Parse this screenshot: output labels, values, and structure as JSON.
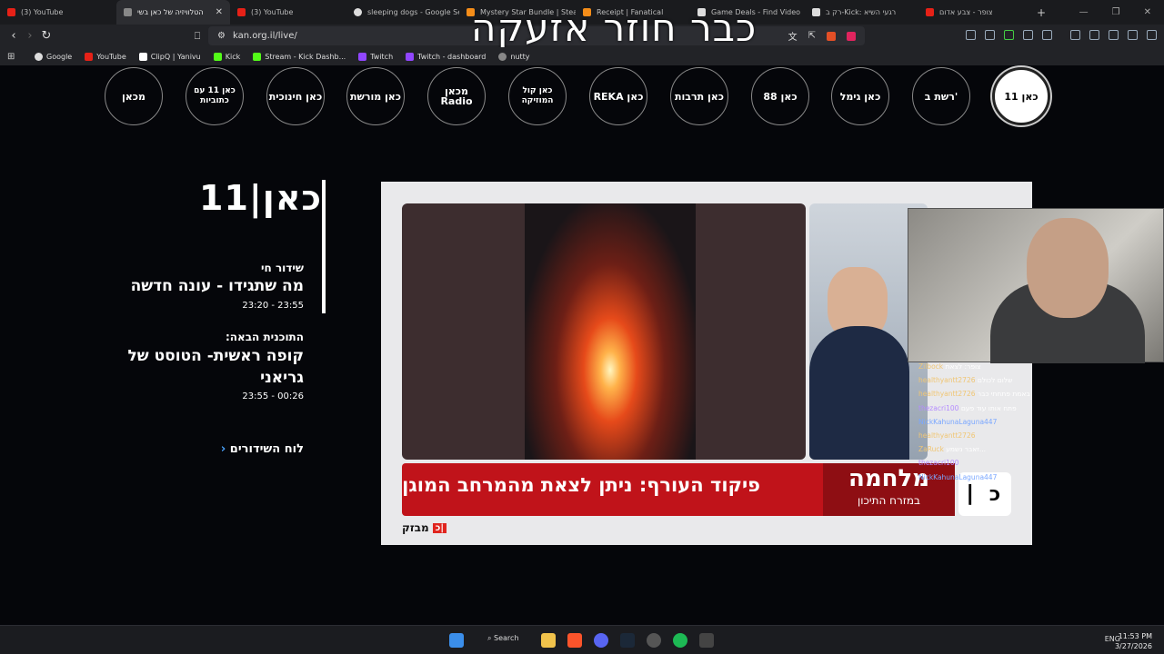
{
  "tabs": [
    {
      "label": "(3) YouTube",
      "color": "#e62117"
    },
    {
      "label": "הטלוויזיה של כאן בשי",
      "color": "#888"
    },
    {
      "label": "(3) YouTube",
      "color": "#e62117"
    },
    {
      "label": "sleeping dogs - Google Se",
      "color": "#ddd"
    },
    {
      "label": "Mystery Star Bundle | Stea",
      "color": "#f58d19"
    },
    {
      "label": "Receipt | Fanatical",
      "color": "#f58d19"
    },
    {
      "label": "Game Deals - Find Video",
      "color": "#ddd"
    },
    {
      "label": "רק ב-Kick: רגעי השיא",
      "color": "#ddd"
    },
    {
      "label": "צופר - צבע אדום",
      "color": "#e62117"
    }
  ],
  "address": {
    "url": "kan.org.il/live/"
  },
  "overlay_title": "כבר חוזר אזעקה",
  "bookmarks": [
    "Google",
    "YouTube",
    "ClipQ | Yanivu",
    "Kick",
    "Stream - Kick Dashb...",
    "Twitch",
    "Twitch - dashboard",
    "nutty"
  ],
  "channels": [
    "מכאן",
    "כאן 11 עם כתוביות",
    "כאן חינוכית",
    "כאן מורשת",
    "מכאן Radio",
    "כאן קול המוזיקה",
    "REKA כאן",
    "כאן תרבות",
    "כאן 88",
    "כאן גימל",
    "רשת ב'",
    "כאן 11"
  ],
  "logo": "כאן|11",
  "live": {
    "label": "שידור חי",
    "title": "מה שתגידו - עונה חדשה",
    "time": "23:20 - 23:55"
  },
  "next": {
    "label": "התוכנית הבאה:",
    "title": "קופה ראשית- הטוסט של גריאני",
    "time": "23:55 - 00:26"
  },
  "schedule_link": "לוח השידורים",
  "ticker": {
    "text": "פיקוד העורף: ניתן לצאת מהמרחב המוגן",
    "badge_top": "מלחמה",
    "badge_bottom": "במזרח התיכון",
    "mivzak": "מבזק"
  },
  "chat": [
    {
      "user": "Zilbock",
      "msg": "צופר: לצאת"
    },
    {
      "user": "healthyantt2726",
      "msg": "שלום לכולם"
    },
    {
      "user": "healthyantt2726",
      "msg": "באמת פתחתי כבר"
    },
    {
      "user": "thezacri100",
      "msg": "פתח אותו עוד פעם"
    },
    {
      "user": "NickKahunaLaguna447",
      "msg": ""
    },
    {
      "user": "healthyantt2726",
      "msg": ""
    },
    {
      "user": "ZaRuck",
      "msg": "זאבר נשמע..."
    },
    {
      "user": "thezacri100",
      "msg": ""
    },
    {
      "user": "NickKahunaLaguna447",
      "msg": ""
    }
  ],
  "clock": {
    "time": "11:53 PM",
    "date": "3/27/2026"
  },
  "tray": "ENG",
  "search_label": "Search"
}
